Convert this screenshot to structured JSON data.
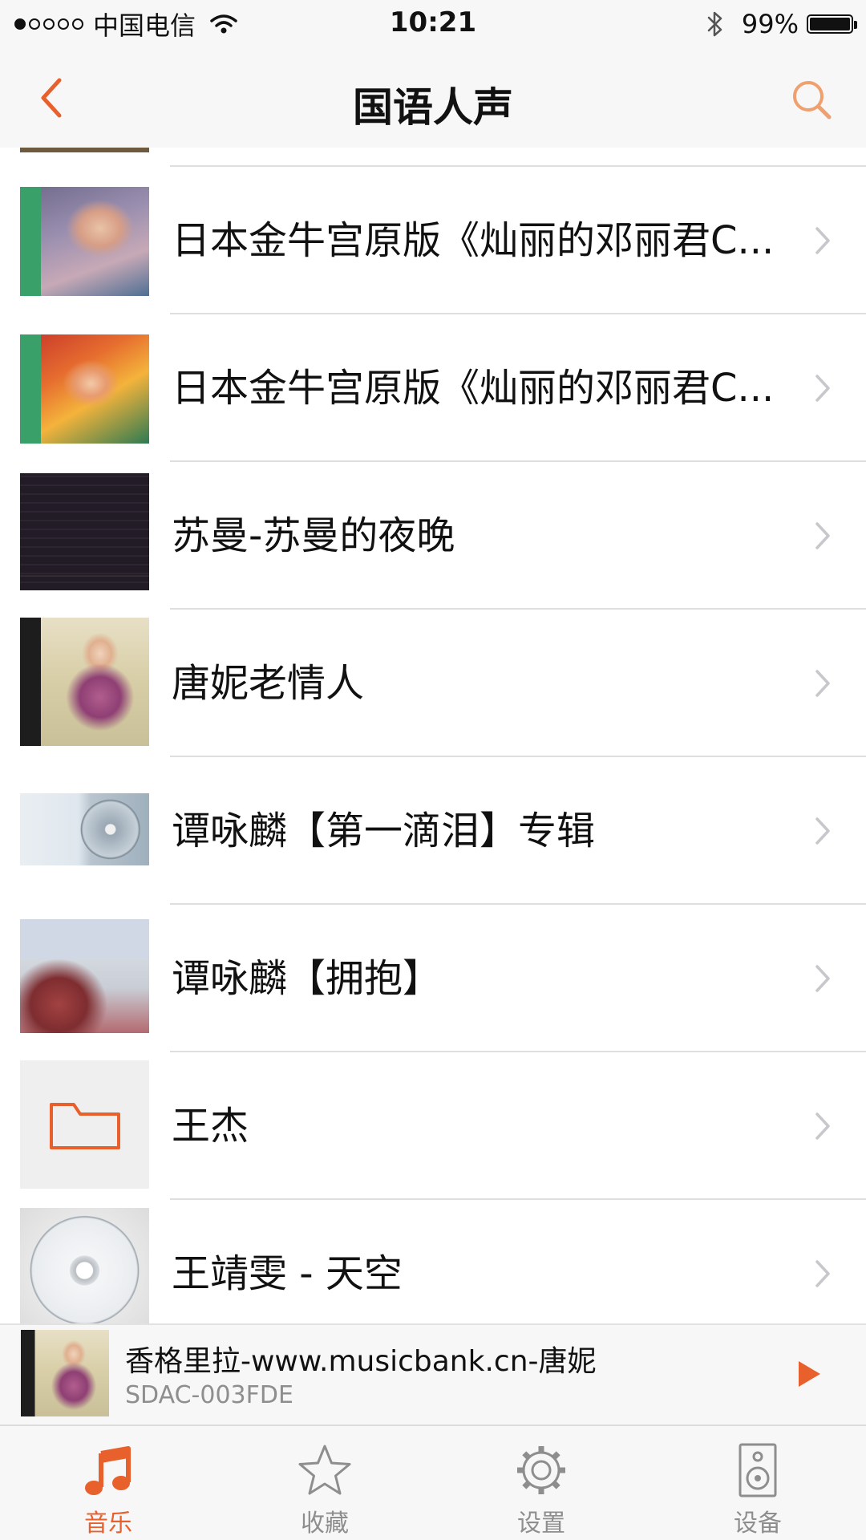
{
  "status_bar": {
    "carrier": "中国电信",
    "time": "10:21",
    "battery": "99%",
    "battery_level": 0.99
  },
  "nav": {
    "title": "国语人声"
  },
  "colors": {
    "accent": "#e8602c",
    "separator": "#dedede",
    "bar_background": "#f7f7f7",
    "secondary_text": "#8e8e8e",
    "chevron": "#c7c7cc"
  },
  "list": {
    "items": [
      {
        "title": "日本金牛宫原版《灿丽的邓丽君C...",
        "thumb": "album-cover"
      },
      {
        "title": "日本金牛宫原版《灿丽的邓丽君C...",
        "thumb": "album-cover"
      },
      {
        "title": "苏曼-苏曼的夜晚",
        "thumb": "album-cover"
      },
      {
        "title": "唐妮老情人",
        "thumb": "album-cover"
      },
      {
        "title": "谭咏麟【第一滴泪】专辑",
        "thumb": "album-cover"
      },
      {
        "title": "谭咏麟【拥抱】",
        "thumb": "album-cover"
      },
      {
        "title": "王杰",
        "thumb": "folder-icon"
      },
      {
        "title": "王靖雯 - 天空",
        "thumb": "cd-disc"
      }
    ]
  },
  "now_playing": {
    "title": "香格里拉-www.musicbank.cn-唐妮",
    "subtitle": "SDAC-003FDE",
    "action_icon": "play-icon"
  },
  "tabs": [
    {
      "label": "音乐",
      "icon": "music-note-icon",
      "active": true
    },
    {
      "label": "收藏",
      "icon": "star-icon",
      "active": false
    },
    {
      "label": "设置",
      "icon": "gear-icon",
      "active": false
    },
    {
      "label": "设备",
      "icon": "speaker-icon",
      "active": false
    }
  ]
}
